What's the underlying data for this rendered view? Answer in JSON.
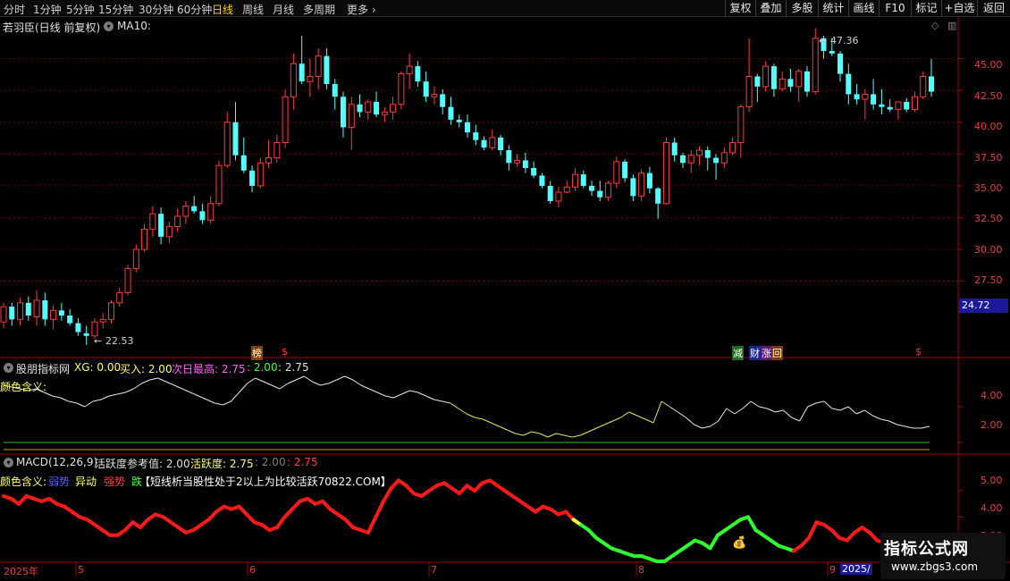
{
  "periods": [
    "分时",
    "1分钟",
    "5分钟",
    "15分钟",
    "30分钟",
    "60分钟",
    "日线",
    "周线",
    "月线",
    "多周期",
    "更多"
  ],
  "active_period": "日线",
  "toolbar": [
    "复权",
    "叠加",
    "多股",
    "统计",
    "画线",
    "F10",
    "+自选",
    "返回"
  ],
  "toolbar_bookmark": "标记",
  "stock_title": "若羽臣(日线 前复权)",
  "ma_label": "MA10:",
  "price_axis": [
    "45.00",
    "42.50",
    "40.00",
    "37.50",
    "35.00",
    "32.50",
    "30.00",
    "27.50"
  ],
  "current_price": "24.72",
  "high_label": "47.36",
  "low_label": "22.53",
  "markers": [
    "榜",
    "$",
    "减",
    "财",
    "涨",
    "回",
    "$"
  ],
  "panel1": {
    "title": "股朋指标网",
    "xg": "XG: 0.00",
    "buy": "买入: 2.00",
    "next_high": "次日最高: 2.75",
    "val_a": ": 2.00",
    "val_b": ": 2.75",
    "legend": "颜色含义:",
    "axis": [
      "4.00",
      "2.00"
    ]
  },
  "panel2": {
    "title": "MACD(12,26,9)",
    "ref": "活跃度参考值: 2.00",
    "act": "活跃度: 2.75",
    "v1": ": 2.00",
    "v2": ": 2.75",
    "legend_title": "颜色含义:",
    "leg_weak": "弱势",
    "leg_move": "异动",
    "leg_strong": "强势",
    "leg_down": "跌",
    "note": "【短线析当股性处于2以上为比较活跃70822.COM】",
    "axis": [
      "5.00",
      "4.00",
      "3.00"
    ]
  },
  "months": [
    "2025年",
    "5",
    "6",
    "7",
    "8",
    "9",
    "2025/"
  ],
  "watermark": {
    "line1": "指标公式网",
    "line2": "www.zbgs3.com"
  },
  "colors": {
    "up": "#ff3c3c",
    "down": "#54ffff",
    "grid": "#8b0000",
    "axis": "#a00000",
    "accent": "#ffd000"
  },
  "chart_data": [
    {
      "type": "candlestick",
      "title": "若羽臣(日线 前复权)",
      "ylim": [
        21.5,
        47.5
      ],
      "y_ticks": [
        27.5,
        30,
        32.5,
        35,
        37.5,
        40,
        42.5,
        45
      ],
      "annotations": {
        "high": 47.36,
        "low": 22.53,
        "last": 24.72
      },
      "ohlc": [
        [
          24.3,
          25.8,
          23.8,
          25.5
        ],
        [
          25.5,
          25.8,
          24.0,
          24.5
        ],
        [
          24.5,
          26.2,
          24.0,
          25.8
        ],
        [
          25.8,
          26.3,
          24.4,
          24.8
        ],
        [
          24.7,
          26.8,
          24.0,
          26.0
        ],
        [
          26.0,
          26.6,
          24.0,
          24.5
        ],
        [
          24.5,
          25.6,
          23.7,
          25.2
        ],
        [
          25.2,
          25.8,
          24.4,
          24.8
        ],
        [
          24.8,
          25.3,
          24.0,
          24.2
        ],
        [
          24.2,
          24.6,
          23.2,
          23.5
        ],
        [
          23.4,
          24.0,
          22.5,
          23.2
        ],
        [
          23.2,
          24.6,
          23.0,
          24.3
        ],
        [
          24.3,
          25.0,
          23.8,
          24.5
        ],
        [
          24.5,
          26.0,
          24.2,
          25.8
        ],
        [
          25.8,
          27.0,
          25.5,
          26.6
        ],
        [
          26.6,
          28.8,
          26.4,
          28.5
        ],
        [
          28.5,
          30.4,
          28.2,
          30.0
        ],
        [
          30.0,
          32.0,
          29.8,
          31.6
        ],
        [
          31.6,
          33.4,
          31.0,
          32.8
        ],
        [
          32.8,
          33.3,
          30.4,
          31.0
        ],
        [
          31.0,
          32.2,
          30.5,
          31.8
        ],
        [
          31.8,
          33.2,
          31.4,
          32.6
        ],
        [
          32.6,
          33.8,
          32.0,
          33.4
        ],
        [
          33.4,
          34.2,
          32.8,
          33.0
        ],
        [
          33.0,
          33.6,
          32.0,
          32.3
        ],
        [
          32.3,
          34.2,
          32.0,
          33.6
        ],
        [
          33.6,
          37.0,
          33.4,
          36.6
        ],
        [
          36.6,
          40.8,
          36.4,
          40.0
        ],
        [
          40.0,
          41.6,
          37.0,
          37.4
        ],
        [
          37.4,
          38.8,
          36.0,
          36.2
        ],
        [
          36.2,
          36.6,
          34.5,
          35.0
        ],
        [
          35.0,
          37.2,
          34.8,
          36.8
        ],
        [
          36.8,
          38.6,
          36.4,
          37.2
        ],
        [
          37.2,
          39.0,
          36.8,
          38.4
        ],
        [
          38.4,
          42.6,
          38.0,
          42.0
        ],
        [
          42.0,
          45.4,
          41.0,
          44.6
        ],
        [
          44.6,
          46.8,
          43.0,
          43.2
        ],
        [
          43.2,
          45.0,
          42.0,
          43.6
        ],
        [
          43.6,
          45.8,
          42.6,
          45.2
        ],
        [
          45.2,
          45.8,
          42.6,
          43.0
        ],
        [
          43.0,
          43.4,
          41.0,
          42.0
        ],
        [
          42.0,
          42.4,
          38.8,
          39.6
        ],
        [
          39.6,
          42.0,
          37.8,
          41.4
        ],
        [
          41.4,
          42.2,
          40.4,
          40.8
        ],
        [
          40.8,
          41.8,
          40.2,
          41.6
        ],
        [
          41.6,
          42.4,
          40.4,
          40.6
        ],
        [
          40.6,
          41.2,
          40.0,
          40.8
        ],
        [
          40.8,
          42.0,
          40.2,
          41.4
        ],
        [
          41.4,
          44.0,
          41.0,
          43.8
        ],
        [
          43.8,
          45.4,
          42.6,
          44.4
        ],
        [
          44.4,
          44.8,
          42.8,
          43.2
        ],
        [
          43.2,
          44.0,
          41.6,
          42.0
        ],
        [
          42.0,
          42.8,
          41.4,
          42.2
        ],
        [
          42.2,
          42.6,
          40.6,
          41.2
        ],
        [
          41.2,
          42.0,
          39.8,
          40.2
        ],
        [
          40.2,
          40.6,
          39.6,
          40.0
        ],
        [
          40.0,
          40.6,
          38.8,
          39.2
        ],
        [
          39.2,
          39.8,
          38.2,
          38.6
        ],
        [
          38.6,
          38.9,
          37.8,
          38.0
        ],
        [
          38.0,
          39.4,
          37.8,
          38.8
        ],
        [
          38.8,
          39.0,
          37.4,
          37.8
        ],
        [
          37.8,
          38.2,
          36.2,
          36.8
        ],
        [
          36.8,
          37.5,
          36.5,
          37.0
        ],
        [
          37.0,
          37.6,
          36.0,
          36.4
        ],
        [
          36.4,
          36.9,
          35.6,
          35.8
        ],
        [
          35.8,
          36.0,
          34.8,
          35.0
        ],
        [
          35.0,
          35.4,
          33.6,
          33.8
        ],
        [
          33.8,
          34.9,
          33.3,
          34.5
        ],
        [
          34.5,
          35.4,
          34.4,
          34.9
        ],
        [
          34.9,
          36.4,
          34.6,
          35.9
        ],
        [
          35.9,
          36.2,
          34.8,
          35.0
        ],
        [
          35.0,
          35.4,
          34.2,
          34.6
        ],
        [
          34.6,
          35.4,
          33.8,
          34.1
        ],
        [
          34.1,
          35.4,
          33.8,
          35.2
        ],
        [
          35.2,
          37.3,
          34.8,
          36.9
        ],
        [
          36.9,
          37.1,
          35.3,
          35.6
        ],
        [
          35.6,
          35.9,
          33.8,
          34.2
        ],
        [
          34.2,
          36.3,
          33.8,
          36.0
        ],
        [
          36.0,
          36.5,
          34.4,
          34.8
        ],
        [
          34.8,
          34.9,
          32.4,
          33.6
        ],
        [
          33.6,
          38.8,
          33.5,
          38.4
        ],
        [
          38.4,
          38.8,
          36.9,
          37.4
        ],
        [
          37.4,
          37.6,
          36.4,
          36.8
        ],
        [
          36.8,
          37.8,
          36.0,
          37.4
        ],
        [
          37.4,
          38.1,
          36.6,
          37.8
        ],
        [
          37.8,
          38.1,
          36.2,
          37.2
        ],
        [
          37.2,
          37.5,
          35.5,
          36.8
        ],
        [
          36.8,
          38.0,
          36.4,
          37.6
        ],
        [
          37.6,
          38.8,
          37.4,
          38.4
        ],
        [
          38.4,
          41.4,
          37.2,
          41.2
        ],
        [
          41.2,
          46.6,
          40.8,
          43.6
        ],
        [
          43.6,
          43.8,
          41.6,
          42.8
        ],
        [
          42.8,
          44.8,
          42.4,
          44.4
        ],
        [
          44.4,
          44.6,
          42.0,
          42.6
        ],
        [
          42.6,
          44.0,
          42.4,
          43.4
        ],
        [
          43.4,
          44.2,
          42.4,
          42.8
        ],
        [
          42.8,
          44.2,
          41.6,
          44.0
        ],
        [
          44.0,
          44.4,
          42.0,
          42.4
        ],
        [
          42.4,
          47.4,
          42.2,
          46.6
        ],
        [
          46.6,
          46.8,
          45.0,
          45.6
        ],
        [
          45.6,
          46.6,
          45.2,
          45.4
        ],
        [
          45.4,
          45.6,
          43.2,
          43.8
        ],
        [
          43.8,
          44.6,
          41.4,
          42.2
        ],
        [
          42.2,
          43.0,
          41.4,
          41.8
        ],
        [
          41.8,
          42.6,
          40.2,
          42.2
        ],
        [
          42.2,
          43.4,
          41.0,
          41.4
        ],
        [
          41.4,
          42.6,
          40.6,
          41.2
        ],
        [
          41.2,
          41.8,
          40.8,
          41.0
        ],
        [
          41.0,
          41.6,
          40.2,
          41.6
        ],
        [
          41.6,
          41.9,
          40.8,
          41.0
        ],
        [
          41.0,
          42.4,
          40.8,
          42.0
        ],
        [
          42.0,
          44.0,
          41.8,
          43.6
        ],
        [
          43.6,
          45.0,
          42.0,
          42.4
        ]
      ]
    },
    {
      "type": "line",
      "title": "股朋指标网",
      "ylim": [
        1.5,
        6.0
      ],
      "series": [
        {
          "values": [
            5.2,
            5.1,
            5.0,
            4.9,
            5.0,
            4.8,
            4.6,
            4.5,
            4.3,
            4.2,
            4.0,
            4.3,
            4.4,
            4.6,
            4.7,
            4.8,
            5.0,
            5.3,
            5.5,
            5.6,
            5.4,
            5.2,
            5.0,
            4.8,
            4.6,
            4.4,
            4.2,
            4.1,
            4.3,
            4.8,
            5.3,
            5.6,
            5.4,
            5.2,
            5.0,
            5.3,
            5.5,
            5.7,
            5.4,
            5.2,
            5.3,
            5.5,
            5.7,
            5.5,
            5.2,
            5.0,
            4.8,
            4.6,
            4.5,
            4.7,
            4.9,
            4.8,
            4.6,
            4.4,
            4.3,
            4.2,
            3.9,
            3.6,
            3.4,
            3.3,
            3.1,
            2.9,
            2.7,
            2.5,
            2.4,
            2.6,
            2.5,
            2.3,
            2.5,
            2.4,
            2.3,
            2.4,
            2.6,
            2.8,
            3.0,
            3.2,
            3.4,
            3.7,
            3.5,
            3.3,
            3.1,
            4.3,
            4.0,
            3.7,
            3.4,
            3.0,
            2.8,
            2.9,
            3.2,
            3.9,
            3.6,
            3.9,
            4.3,
            4.0,
            3.9,
            3.7,
            3.8,
            3.4,
            3.2,
            4.0,
            4.2,
            4.3,
            3.9,
            3.8,
            4.0,
            3.6,
            3.8,
            3.5,
            3.3,
            3.2,
            3.0,
            2.9,
            2.8,
            2.8,
            2.9
          ]
        }
      ],
      "hlines": [
        2.0,
        0.0
      ]
    },
    {
      "type": "line",
      "title": "MACD(12,26,9)",
      "ylim": [
        2.3,
        6.0
      ],
      "series": [
        {
          "values": [
            4.8,
            4.7,
            4.5,
            4.8,
            4.7,
            4.6,
            4.7,
            4.5,
            4.4,
            4.2,
            4.0,
            3.9,
            3.7,
            3.5,
            3.3,
            3.3,
            3.5,
            3.8,
            3.6,
            3.9,
            4.1,
            4.0,
            3.8,
            3.6,
            3.4,
            3.5,
            3.7,
            3.9,
            4.2,
            4.4,
            4.3,
            4.4,
            4.1,
            3.8,
            3.7,
            3.5,
            3.6,
            4.0,
            4.3,
            4.6,
            4.7,
            4.5,
            4.6,
            4.3,
            4.1,
            3.9,
            3.6,
            3.5,
            3.4,
            4.0,
            4.6,
            5.1,
            5.4,
            5.2,
            4.9,
            4.8,
            5.0,
            5.2,
            5.3,
            5.1,
            4.9,
            5.2,
            5.0,
            5.3,
            5.4,
            5.2,
            5.0,
            4.8,
            4.6,
            4.4,
            4.2,
            4.4,
            4.3,
            4.1,
            4.2,
            3.9,
            3.7,
            3.5,
            3.2,
            3.0,
            2.8,
            2.7,
            2.6,
            2.5,
            2.5,
            2.4,
            2.3,
            2.3,
            2.5,
            2.7,
            2.9,
            3.1,
            3.0,
            2.8,
            3.3,
            3.5,
            3.7,
            3.9,
            4.0,
            3.5,
            3.3,
            3.1,
            2.9,
            2.8,
            2.7,
            2.9,
            3.2,
            3.8,
            3.7,
            3.5,
            3.2,
            3.1,
            3.4,
            3.6,
            3.4,
            3.1,
            3.0
          ]
        }
      ]
    }
  ]
}
